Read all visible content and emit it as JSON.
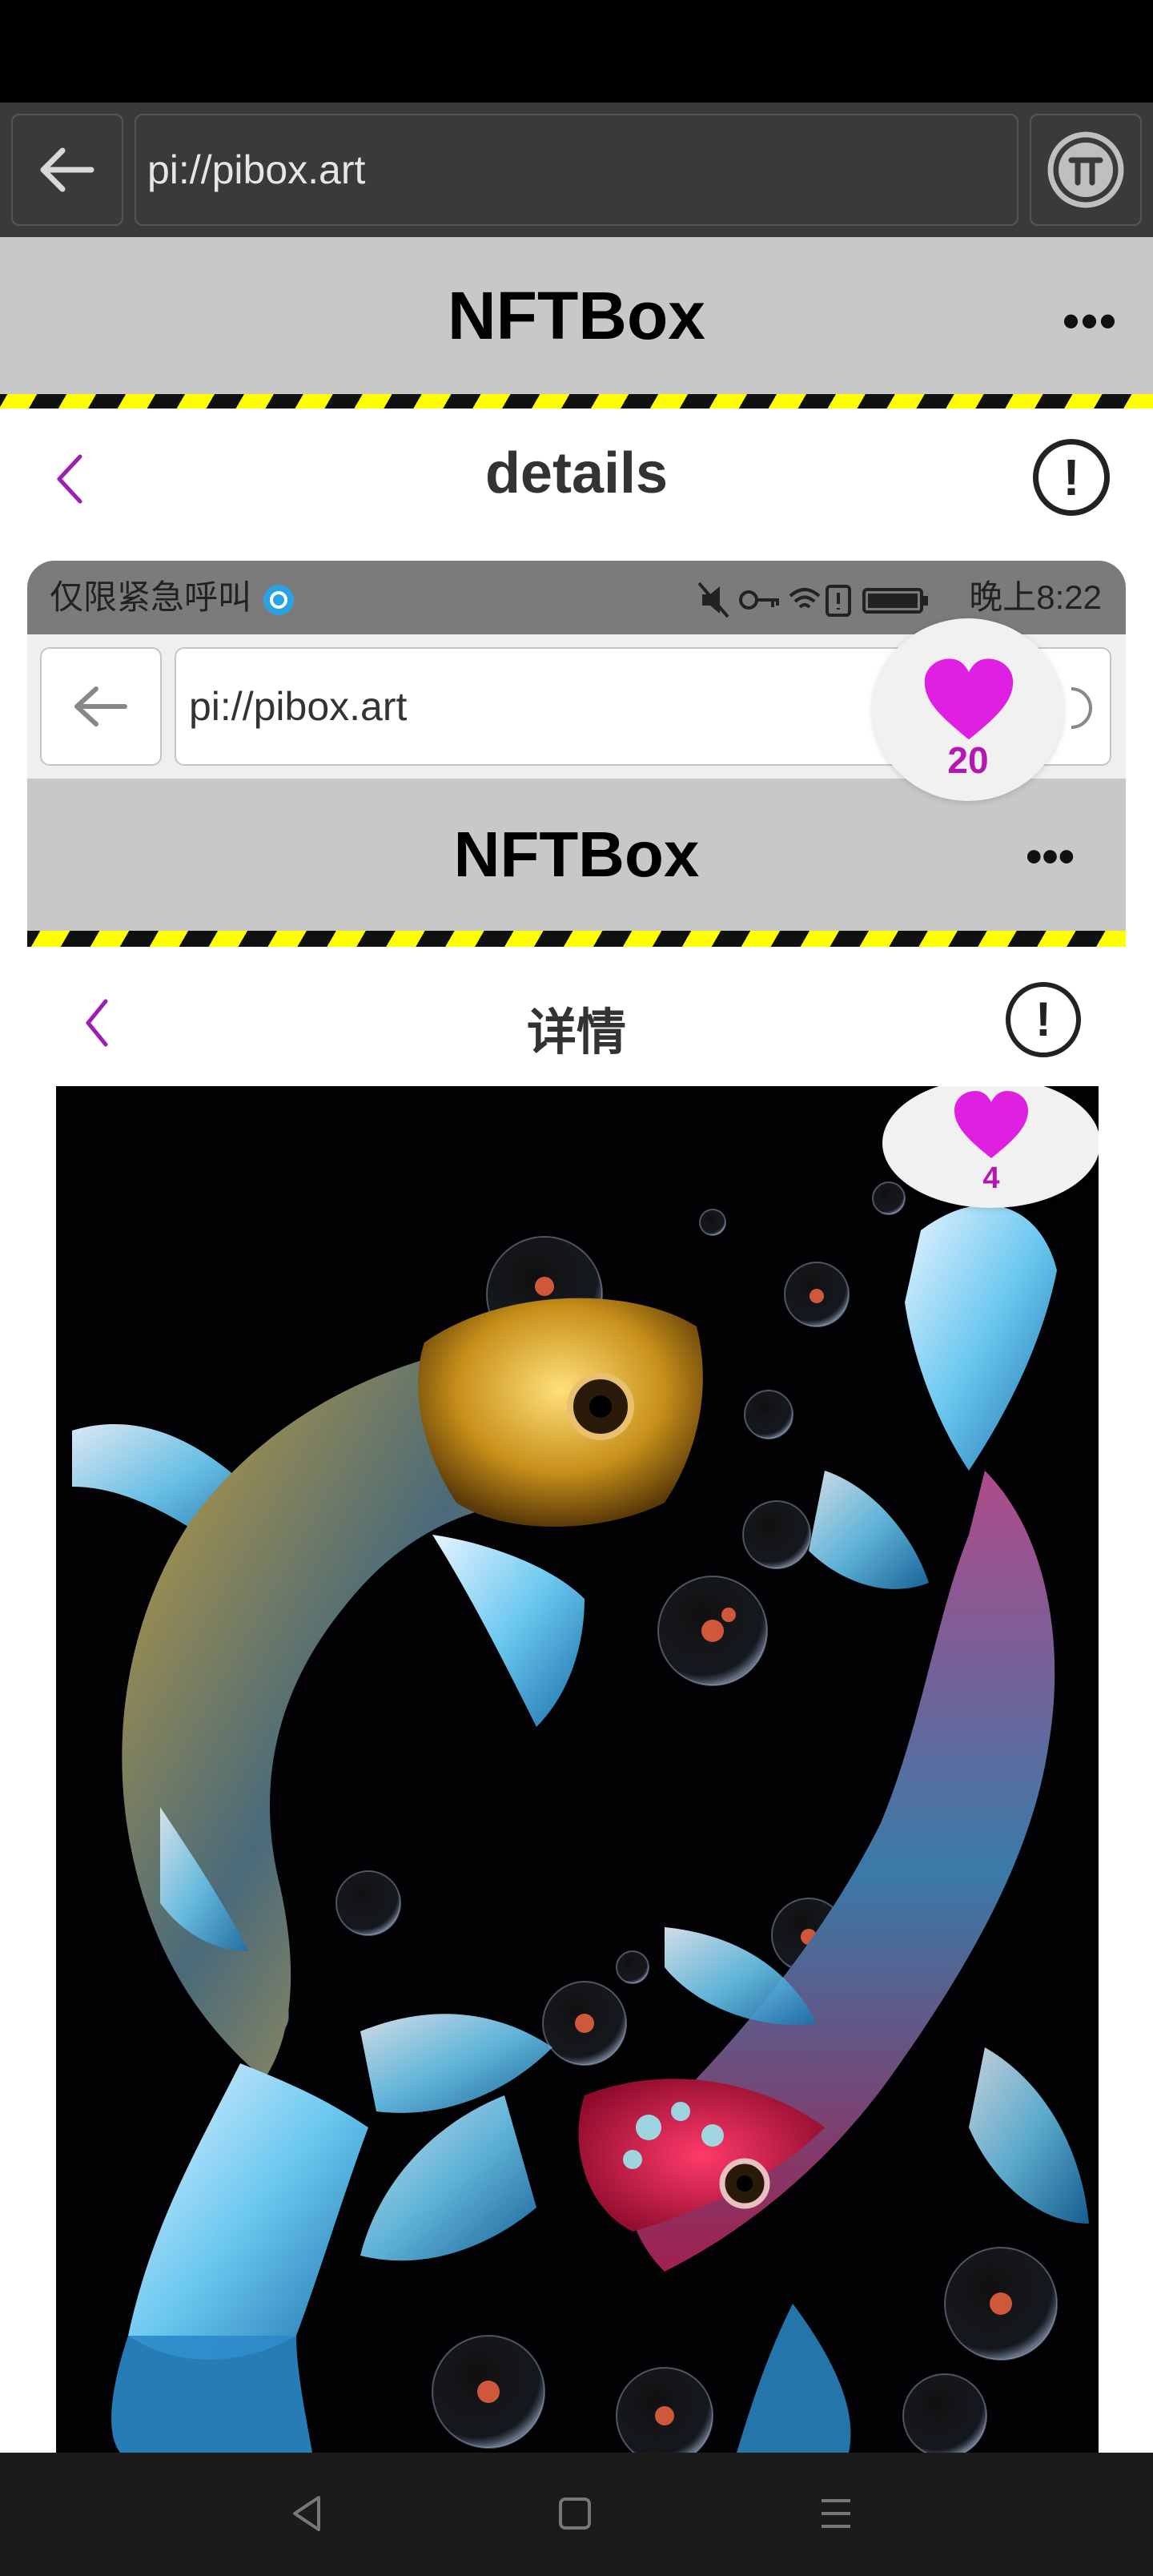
{
  "browser": {
    "url": "pi://pibox.art",
    "back_icon": "arrow-left-icon",
    "pi_icon": "pi-network-icon"
  },
  "app": {
    "title": "NFTBox",
    "menu_label": "•••"
  },
  "page": {
    "title": "details",
    "info_label": "!"
  },
  "like_outer": {
    "count": "20"
  },
  "inner_screenshot": {
    "status_left": "仅限紧急呼叫",
    "status_time": "晚上8:22",
    "url": "pi://pibox.art",
    "app_title": "NFTBox",
    "menu_label": "•••",
    "page_title": "详情",
    "info_label": "!",
    "like_count": "4"
  },
  "colors": {
    "accent_purple": "#b318b3",
    "heart_magenta": "#e020e0",
    "appbar_gray": "#c8c8c8",
    "stripe_yellow": "#ffff00"
  },
  "nav": {
    "back": "nav-back-icon",
    "home": "nav-home-icon",
    "menu": "nav-menu-icon"
  }
}
